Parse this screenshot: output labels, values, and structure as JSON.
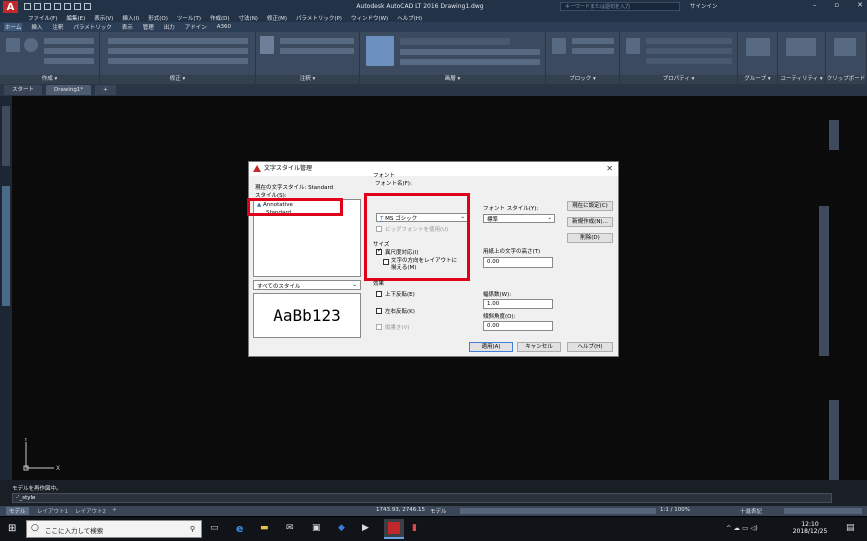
{
  "app": {
    "title": "Autodesk AutoCAD LT 2016  Drawing1.dwg",
    "logo": "A",
    "search_placeholder": "キーワードまたは語句を入力",
    "signin": "サインイン"
  },
  "menu": [
    "ファイル(F)",
    "編集(E)",
    "表示(V)",
    "挿入(I)",
    "形式(O)",
    "ツール(T)",
    "作成(D)",
    "寸法(N)",
    "修正(M)",
    "パラメトリック(P)",
    "ウィンドウ(W)",
    "ヘルプ(H)"
  ],
  "ribbon_tabs": [
    "ホーム",
    "挿入",
    "注釈",
    "パラメトリック",
    "表示",
    "管理",
    "出力",
    "アドイン",
    "A360"
  ],
  "ribbon_panels": [
    "作成 ▾",
    "修正 ▾",
    "注釈 ▾",
    "画層 ▾",
    "ブロック ▾",
    "プロパティ ▾",
    "グループ ▾",
    "ユーティリティ ▾",
    "クリップボード"
  ],
  "doc_tabs": [
    "スタート",
    "Drawing1*",
    "+"
  ],
  "dialog": {
    "title": "文字スタイル管理",
    "current_style_label": "現在の文字スタイル: Standard",
    "styles_label": "スタイル(S):",
    "styles": [
      "Annotative",
      "Standard"
    ],
    "filter": "すべてのスタイル",
    "preview": "AaBb123",
    "font_group": "フォント",
    "font_name_label": "フォント名(F):",
    "font_name": "MS ゴシック",
    "font_style_label": "フォント スタイル(Y):",
    "font_style": "標準",
    "bigfont": "ビッグフォントを使用(U)",
    "size_group": "サイズ",
    "annotative": "異尺度対応(I)",
    "match_orientation": "文字の方向をレイアウトに揃える(M)",
    "paper_height_label": "用紙上の文字の高さ(T)",
    "paper_height": "0.00",
    "effects_group": "効果",
    "upside_down": "上下反転(E)",
    "backwards": "左右反転(K)",
    "vertical": "縦書き(V)",
    "width_label": "幅係数(W):",
    "width": "1.00",
    "oblique_label": "傾斜角度(O):",
    "oblique": "0.00",
    "btn_current": "現在に設定(C)",
    "btn_new": "新規作成(N)...",
    "btn_delete": "削除(D)",
    "btn_apply": "適用(A)",
    "btn_cancel": "キャンセル",
    "btn_help": "ヘルプ(H)"
  },
  "command": {
    "line1": "モデルを再作図中。",
    "line2": "-'_style"
  },
  "layout_tabs": [
    "モデル",
    "レイアウト1",
    "レイアウト2",
    "+"
  ],
  "status": {
    "coords": "1743.93, 2746.15",
    "model": "モデル",
    "scale": "1:1 / 100%",
    "units": "十進表記"
  },
  "taskbar": {
    "search": "ここに入力して検索",
    "time": "12:10",
    "date": "2018/12/25"
  },
  "colors": {
    "highlight": "#e0001a",
    "accent": "#c0282b"
  }
}
